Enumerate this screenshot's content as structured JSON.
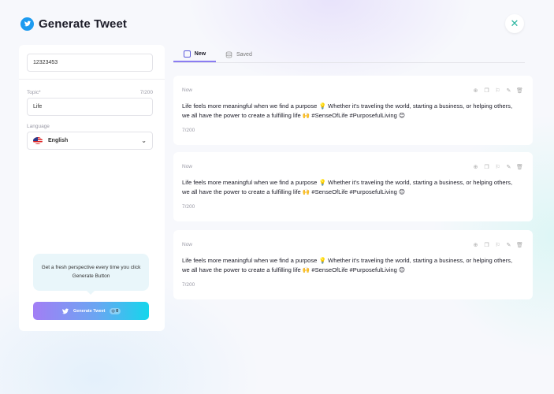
{
  "header": {
    "title": "Generate Tweet",
    "logo_icon": "twitter-bird-icon",
    "close_icon": "close-icon"
  },
  "form": {
    "id_value": "12323453",
    "topic_label": "Topic*",
    "topic_counter": "7/200",
    "topic_value": "Life",
    "language_label": "Language",
    "language_value": "English",
    "language_flag": "us-flag-icon"
  },
  "tip_text": "Get a fresh perspective every time you click Generate Button",
  "generate_button": {
    "label": "Generate Tweet",
    "badge": "0"
  },
  "tabs": [
    {
      "label": "New",
      "icon": "square-icon",
      "active": true
    },
    {
      "label": "Saved",
      "icon": "database-icon",
      "active": false
    }
  ],
  "tweets": [
    {
      "time": "Now",
      "text": "Life feels more meaningful when we find a purpose 💡 Whether it's traveling the world, starting a business, or helping others, we all have the power to create a fulfilling life 🙌 #SenseOfLife #PurposefulLiving 😊",
      "count": "7/200"
    },
    {
      "time": "Now",
      "text": "Life feels more meaningful when we find a purpose 💡 Whether it's traveling the world, starting a business, or helping others, we all have the power to create a fulfilling life 🙌 #SenseOfLife #PurposefulLiving 😊",
      "count": "7/200"
    },
    {
      "time": "Now",
      "text": "Life feels more meaningful when we find a purpose 💡 Whether it's traveling the world, starting a business, or helping others, we all have the power to create a fulfilling life 🙌 #SenseOfLife #PurposefulLiving 😊",
      "count": "7/200"
    }
  ],
  "colors": {
    "accent": "#8a7cf2",
    "twitter": "#1d9bf0",
    "gradient_start": "#a27ef5",
    "gradient_end": "#14d6ec"
  }
}
